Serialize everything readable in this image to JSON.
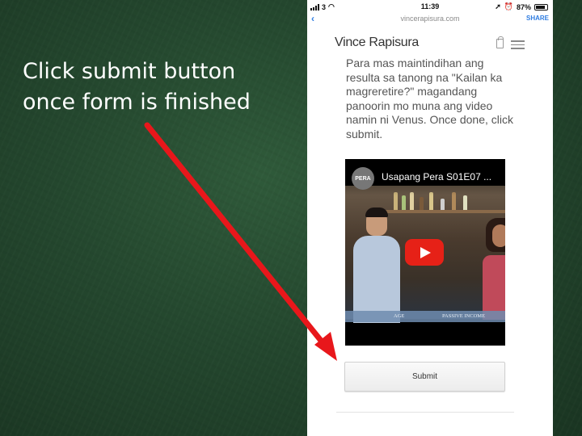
{
  "caption": {
    "line1": "Click submit button",
    "line2": "once form is finished"
  },
  "status_bar": {
    "carrier": "3",
    "time": "11:39",
    "battery": "87%"
  },
  "browser": {
    "url": "vincerapisura.com",
    "share_label": "SHARE"
  },
  "site": {
    "title": "Vince Rapisura"
  },
  "content": {
    "paragraph": "Para mas maintindihan ang resulta sa tanong na \"Kailan ka magreretire?\" magandang panoorin mo muna ang video namin ni Venus. Once done, click submit."
  },
  "video": {
    "channel_label": "PERA",
    "title": "Usapang Pera S01E07 ...",
    "chyron_left": "AGE",
    "chyron_right": "PASSIVE INCOME"
  },
  "form": {
    "submit_label": "Submit"
  },
  "colors": {
    "arrow": "#e8171b",
    "link": "#2f7de1",
    "play": "#e62117"
  }
}
